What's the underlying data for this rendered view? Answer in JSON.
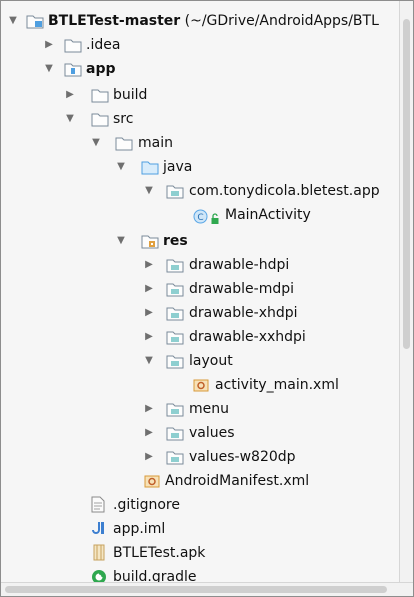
{
  "tree": {
    "root_name": "BTLETest-master",
    "root_path": " (~/GDrive/AndroidApps/BTL",
    "idea": ".idea",
    "app": "app",
    "build": "build",
    "src": "src",
    "main": "main",
    "java": "java",
    "package": "com.tonydicola.bletest.app",
    "main_activity": "MainActivity",
    "res": "res",
    "drawable_hdpi": "drawable-hdpi",
    "drawable_mdpi": "drawable-mdpi",
    "drawable_xhdpi": "drawable-xhdpi",
    "drawable_xxhdpi": "drawable-xxhdpi",
    "layout": "layout",
    "activity_main": "activity_main.xml",
    "menu": "menu",
    "values": "values",
    "values_w820dp": "values-w820dp",
    "manifest": "AndroidManifest.xml",
    "gitignore": ".gitignore",
    "app_iml": "app.iml",
    "apk": "BTLETest.apk",
    "build_gradle": "build.gradle"
  },
  "icons": {
    "folder": "folder-icon",
    "module": "module-folder-icon",
    "source_root": "source-root-icon",
    "package": "package-icon",
    "resource_root": "resource-root-icon",
    "class": "class-icon",
    "xml": "xml-file-icon",
    "manifest": "manifest-icon",
    "text": "text-file-icon",
    "iml": "iml-file-icon",
    "apk": "apk-file-icon",
    "gradle": "gradle-file-icon"
  },
  "colors": {
    "folder_outline": "#7a8a99",
    "folder_fill": "#fdfdfd",
    "source_blue": "#4f9fe0",
    "package_teal": "#8ecfd0",
    "res_orange": "#e0a040",
    "class_blue": "#59a6e6",
    "gradle_green": "#2fa84f"
  }
}
